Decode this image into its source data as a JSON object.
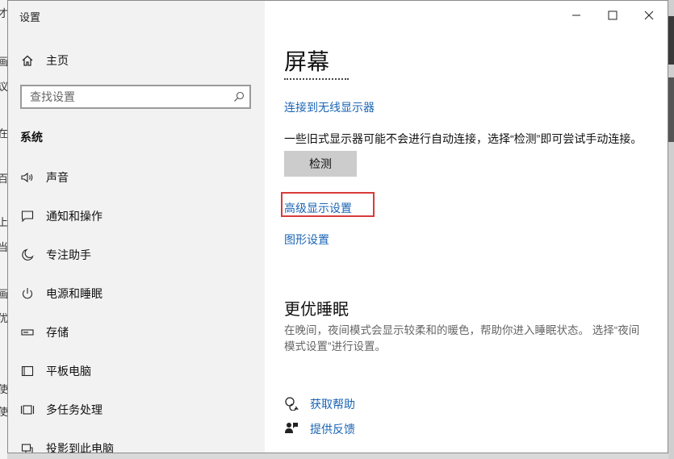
{
  "window": {
    "title": "设置"
  },
  "sidebar": {
    "home_label": "主页",
    "search_placeholder": "查找设置",
    "section_label": "系统",
    "items": [
      {
        "label": "声音",
        "icon": "speaker-icon"
      },
      {
        "label": "通知和操作",
        "icon": "notification-icon"
      },
      {
        "label": "专注助手",
        "icon": "moon-icon"
      },
      {
        "label": "电源和睡眠",
        "icon": "power-icon"
      },
      {
        "label": "存储",
        "icon": "storage-icon"
      },
      {
        "label": "平板电脑",
        "icon": "tablet-icon"
      },
      {
        "label": "多任务处理",
        "icon": "multitask-icon"
      },
      {
        "label": "投影到此电脑",
        "icon": "project-icon"
      }
    ]
  },
  "main": {
    "title": "屏幕",
    "wireless_link": "连接到无线显示器",
    "detect_desc": "一些旧式显示器可能不会进行自动连接，选择“检测”即可尝试手动连接。",
    "detect_button": "检测",
    "advanced_link": "高级显示设置",
    "graphics_link": "图形设置",
    "sleep_heading": "更优睡眠",
    "sleep_desc": "在晚间，夜间模式会显示较柔和的暖色，帮助你进入睡眠状态。 选择“夜间模式设置”进行设置。",
    "help_link": "获取帮助",
    "feedback_link": "提供反馈"
  },
  "background": {
    "left_chars": [
      "才",
      "画",
      "议",
      "在",
      "百",
      "上",
      "当",
      "画",
      "优",
      "使",
      "使"
    ]
  },
  "colors": {
    "accent_link": "#1a64b4",
    "highlight_box": "#d93a3a",
    "sidebar_bg": "#f2f2f2"
  }
}
